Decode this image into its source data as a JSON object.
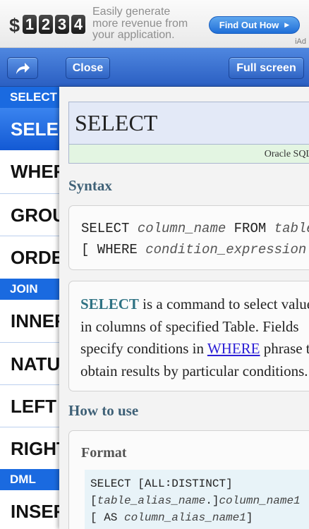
{
  "ad": {
    "dollar": "$",
    "digits": [
      "1",
      "2",
      "3",
      "4"
    ],
    "text_lines": [
      "Easily generate",
      "more revenue from",
      "your application."
    ],
    "button_label": "Find Out How",
    "button_arrow": "▶",
    "tag": "iAd",
    "colors": {
      "button": "#2a78de"
    }
  },
  "toolbar": {
    "share_icon": "share-arrow-icon",
    "close_label": "Close",
    "fullscreen_label": "Full screen",
    "colors": {
      "bar": "#3a6fd0"
    }
  },
  "sidebar": {
    "sections": [
      {
        "label": "SELECT"
      },
      {
        "label": "JOIN"
      },
      {
        "label": "DML"
      }
    ],
    "items": [
      {
        "label": "SELECT",
        "active": true
      },
      {
        "label": "WHERE"
      },
      {
        "label": "GROUP BY"
      },
      {
        "label": "ORDER BY"
      },
      {
        "label": "INNER JOIN"
      },
      {
        "label": "NATURAL JOIN"
      },
      {
        "label": "LEFT JOIN"
      },
      {
        "label": "RIGHT JOIN"
      },
      {
        "label": "INSERT"
      }
    ],
    "colors": {
      "section": "#1a6ae0",
      "active": "#1e63d8"
    }
  },
  "content": {
    "title": "SELECT",
    "subtitle": "Oracle SQL",
    "syntax_heading": "Syntax",
    "syntax": {
      "line1_kw": "SELECT ",
      "line1_var": "column_name",
      "line1_kw2": " FROM ",
      "line1_var2": "table_name",
      "line2_kw": "[ WHERE ",
      "line2_var": "condition_expression",
      "line2_end": " ]"
    },
    "description": {
      "kw": "SELECT",
      "line1_rest": " is a command to select values",
      "line2": "in columns of specified Table. Fields",
      "line3_pre": "specify conditions in ",
      "line3_link": "WHERE",
      "line3_post": " phrase to",
      "line4": "obtain results by particular conditions."
    },
    "howto_heading": "How to use",
    "format_label": "Format",
    "format": {
      "line1_kw": "SELECT [ALL",
      "line1_sep": "∶",
      "line1_kw2": "DISTINCT]",
      "line2_pre": " [",
      "line2_var": "table_alias_name",
      "line2_mid": ".]",
      "line2_var2": "column_name1",
      "line3_pre": "[ AS ",
      "line3_var": "column_alias_name1",
      "line3_end": "]"
    }
  }
}
